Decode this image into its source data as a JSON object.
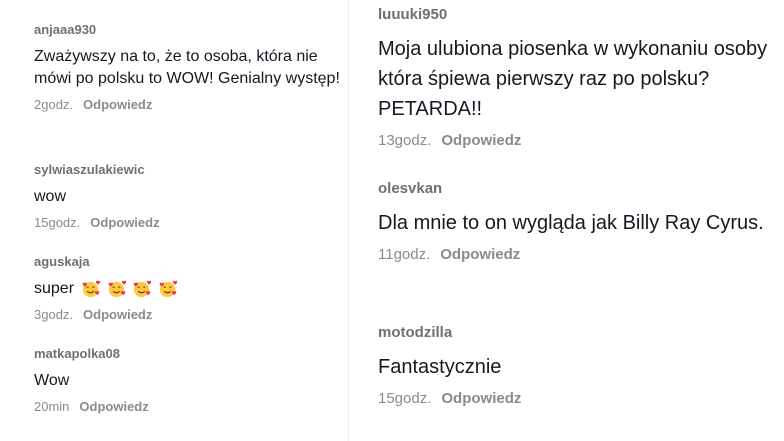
{
  "left": [
    {
      "username": "anjaaa930",
      "text": "Zważywszy na to, że to osoba, która nie mówi po polsku to WOW! Genialny występ!",
      "time": "2godz.",
      "reply": "Odpowiedz"
    },
    {
      "username": "sylwiaszulakiewic",
      "text": "wow",
      "time": "15godz.",
      "reply": "Odpowiedz"
    },
    {
      "username": "aguskaja",
      "text": "super",
      "emoji_icons": [
        "smiling-face-with-hearts-icon",
        "smiling-face-with-hearts-icon",
        "smiling-face-with-hearts-icon",
        "smiling-face-with-hearts-icon"
      ],
      "time": "3godz.",
      "reply": "Odpowiedz"
    },
    {
      "username": "matkapolka08",
      "text": "Wow",
      "time": "20min",
      "reply": "Odpowiedz"
    }
  ],
  "right": [
    {
      "username": "luuuki950",
      "text": "Moja ulubiona piosenka w wykonaniu osoby która śpiewa pierwszy raz po polsku? PETARDA!!",
      "time": "13godz.",
      "reply": "Odpowiedz"
    },
    {
      "username": "olesvkan",
      "text": "Dla mnie to on wygląda jak Billy Ray Cyrus.",
      "time": "11godz.",
      "reply": "Odpowiedz"
    },
    {
      "username": "motodzilla",
      "text": "Fantastycznie",
      "time": "15godz.",
      "reply": "Odpowiedz"
    }
  ],
  "colors": {
    "username": "#6f7077",
    "text": "#161823",
    "meta": "#8a8b91",
    "emoji_face": "#ffc83d",
    "emoji_heart": "#f2315b"
  }
}
